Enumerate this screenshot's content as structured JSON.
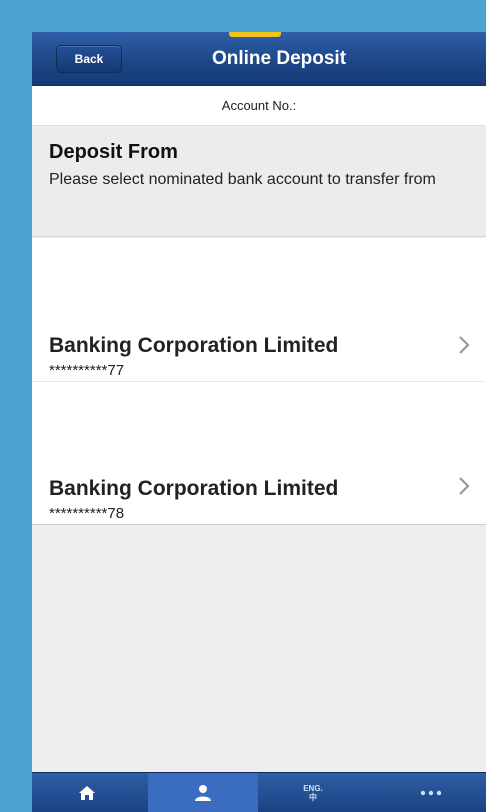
{
  "header": {
    "back_label": "Back",
    "title": "Online Deposit"
  },
  "account": {
    "label": "Account No.:"
  },
  "section": {
    "title": "Deposit From",
    "description": "Please select nominated bank account to transfer from"
  },
  "accounts": [
    {
      "name": "Banking Corporation Limited",
      "number": "**********77"
    },
    {
      "name": "Banking Corporation Limited",
      "number": "**********78"
    }
  ],
  "tabbar": {
    "lang_line1": "ENG.",
    "lang_line2": "中"
  },
  "colors": {
    "frame": "#4aa4cf",
    "navbar": "#1c4585",
    "accent": "#f3c21b",
    "tabbar": "#1a4384"
  }
}
